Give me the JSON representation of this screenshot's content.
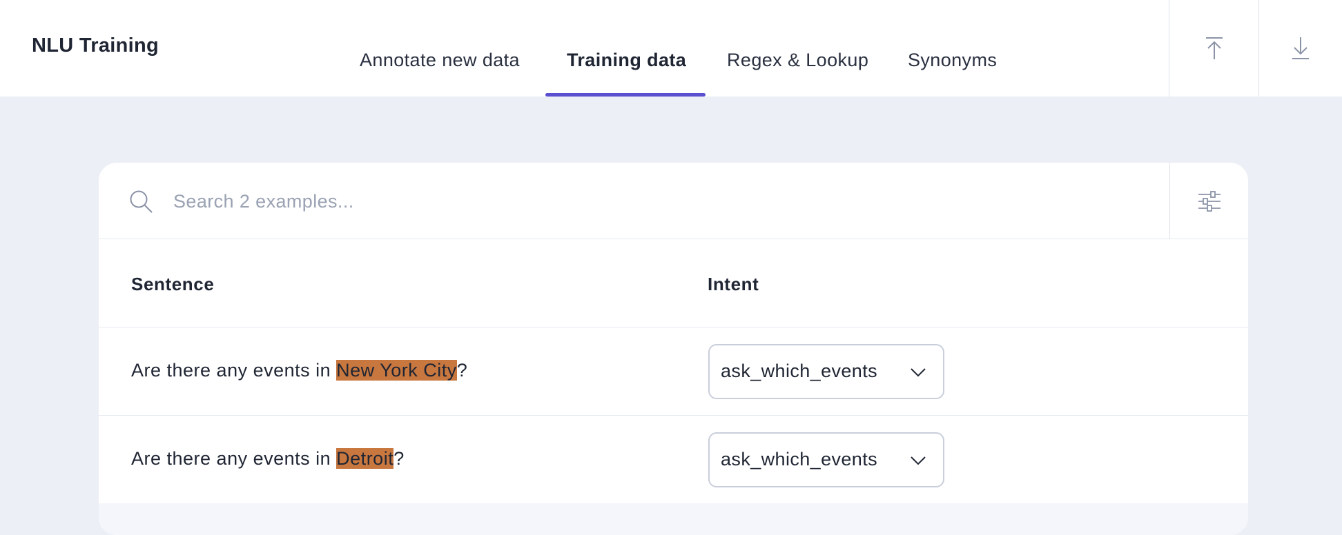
{
  "header": {
    "title": "NLU Training",
    "tabs": [
      {
        "label": "Annotate new data",
        "active": false
      },
      {
        "label": "Training data",
        "active": true
      },
      {
        "label": "Regex & Lookup",
        "active": false
      },
      {
        "label": "Synonyms",
        "active": false
      }
    ],
    "actions": [
      {
        "icon": "upload-icon"
      },
      {
        "icon": "download-icon"
      }
    ]
  },
  "search": {
    "placeholder": "Search 2 examples...",
    "value": "",
    "icon": "search-icon",
    "filter_icon": "filter-sliders-icon"
  },
  "table": {
    "columns": [
      "Sentence",
      "Intent"
    ],
    "rows": [
      {
        "before": "Are there any events in ",
        "entity": "New York City",
        "after": "?",
        "intent": "ask_which_events"
      },
      {
        "before": "Are there any events in ",
        "entity": "Detroit",
        "after": "?",
        "intent": "ask_which_events"
      }
    ]
  },
  "colors": {
    "accent": "#5a4fcf",
    "entity_highlight": "#c8773f",
    "background": "#eceff6"
  }
}
